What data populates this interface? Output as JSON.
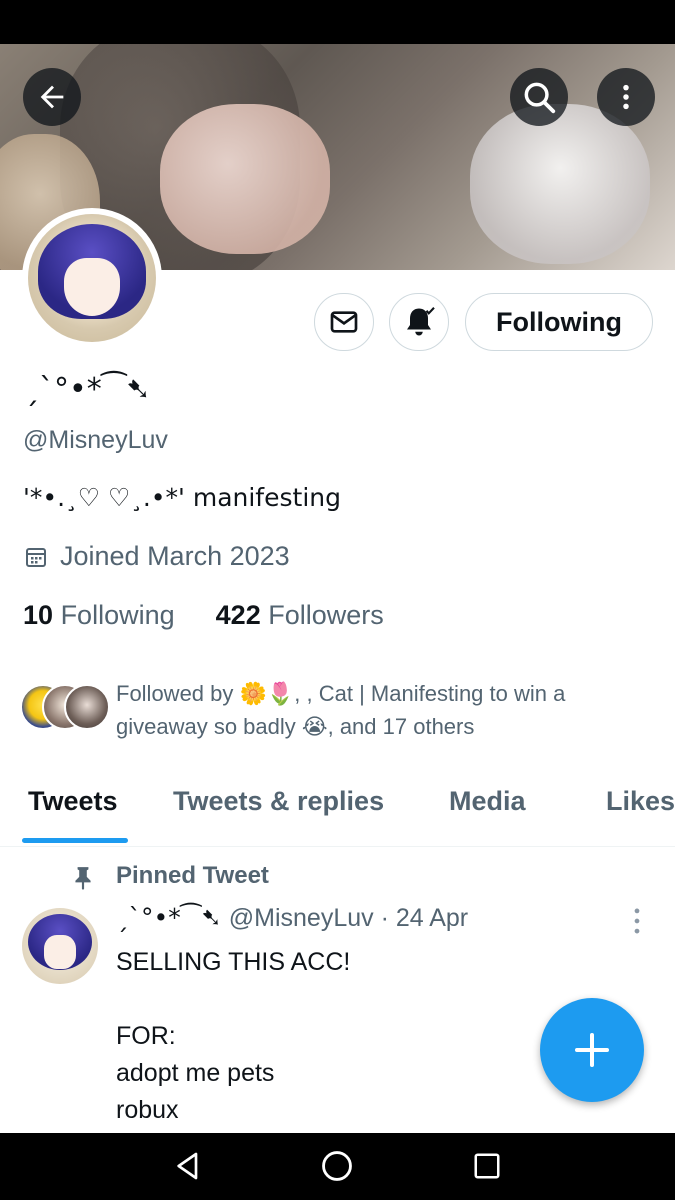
{
  "profile": {
    "display_name": "ˏˋ°•*⁀➷",
    "handle": "@MisneyLuv",
    "bio": "'*•.¸♡ ♡¸.•*'   manifesting",
    "joined": "Joined March 2023",
    "following_count": "10",
    "following_label": "Following",
    "followers_count": "422",
    "followers_label": "Followers",
    "followed_by_text": "Followed by 🌼🌷,        , Cat | Manifesting to win a giveaway so badly 😭, and 17 others"
  },
  "actions": {
    "following_button": "Following"
  },
  "tabs": [
    {
      "label": "Tweets",
      "active": true
    },
    {
      "label": "Tweets & replies",
      "active": false
    },
    {
      "label": "Media",
      "active": false
    },
    {
      "label": "Likes",
      "active": false
    }
  ],
  "pinned_tweet": {
    "label": "Pinned Tweet",
    "author_name": "ˏˋ°•*⁀➷",
    "author_meta": "@MisneyLuv · 24 Apr",
    "lines": [
      "SELLING THIS ACC!",
      "",
      "FOR:",
      "adopt me pets",
      "robux"
    ]
  },
  "colors": {
    "accent": "#1d9bf0",
    "text_primary": "#0f1419",
    "text_secondary": "#536471"
  },
  "icons": [
    "back-arrow-icon",
    "search-icon",
    "more-vertical-icon",
    "mail-icon",
    "bell-icon",
    "calendar-icon",
    "pin-icon",
    "more-dots-icon",
    "plus-icon",
    "nav-back-icon",
    "nav-home-icon",
    "nav-recents-icon"
  ]
}
